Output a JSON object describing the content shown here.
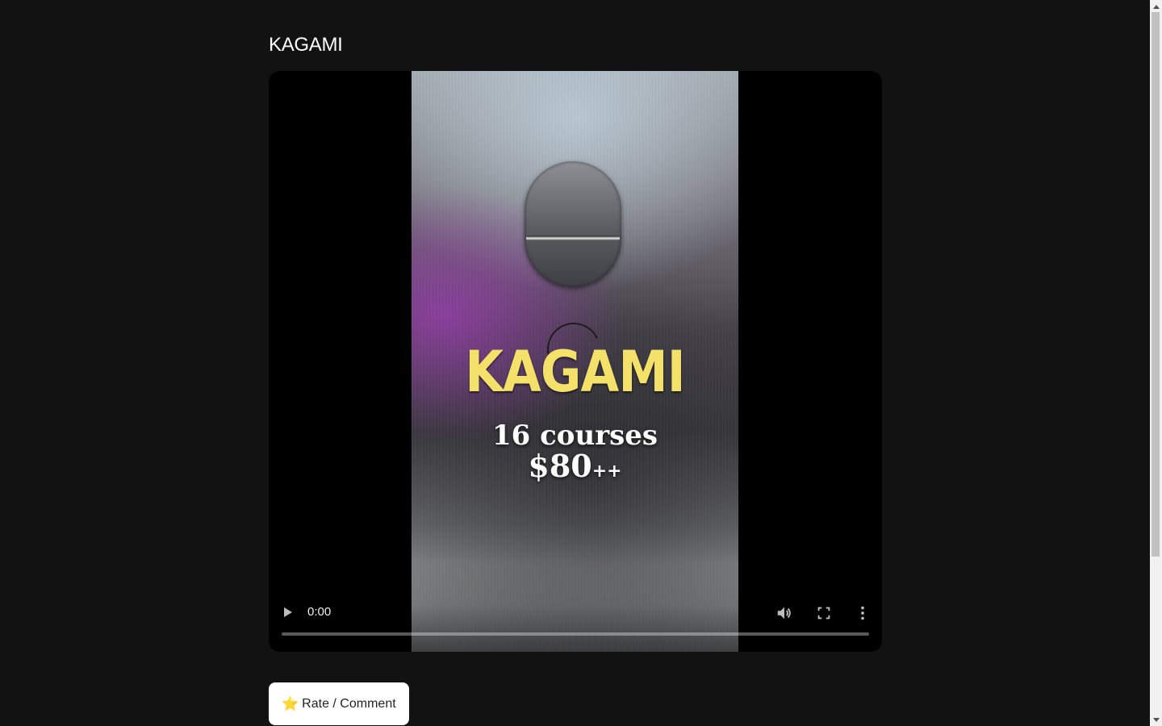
{
  "page": {
    "title": "KAGAMI"
  },
  "video": {
    "overlay_name": "KAGAMI",
    "overlay_courses": "16 courses",
    "overlay_price": "$80",
    "overlay_price_suffix": "++",
    "current_time": "0:00",
    "progress": 0,
    "icons": {
      "play": "play-icon",
      "volume": "volume-icon",
      "fullscreen": "fullscreen-icon",
      "more": "more-options-icon"
    }
  },
  "actions": {
    "rate_comment_icon": "⭐",
    "rate_comment_label": "Rate / Comment"
  },
  "colors": {
    "background": "#121212",
    "overlay_name": "#f3e16a",
    "button_bg": "#ffffff"
  }
}
